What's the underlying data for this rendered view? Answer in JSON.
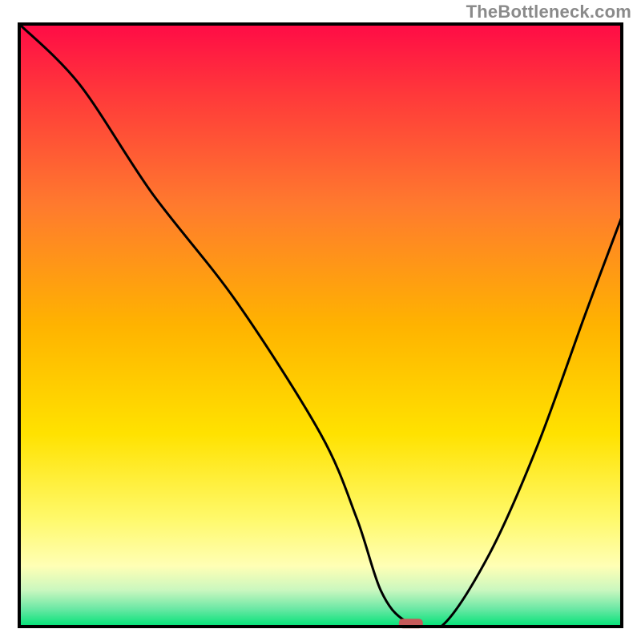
{
  "attribution": "TheBottleneck.com",
  "chart_data": {
    "type": "line",
    "title": "",
    "xlabel": "",
    "ylabel": "",
    "xlim": [
      0,
      100
    ],
    "ylim": [
      0,
      100
    ],
    "grid": false,
    "background": {
      "type": "vertical-gradient",
      "stops": [
        {
          "offset": 0.0,
          "color": "#ff0b46"
        },
        {
          "offset": 0.12,
          "color": "#ff3a3a"
        },
        {
          "offset": 0.3,
          "color": "#ff7a2e"
        },
        {
          "offset": 0.5,
          "color": "#ffb300"
        },
        {
          "offset": 0.68,
          "color": "#ffe200"
        },
        {
          "offset": 0.82,
          "color": "#fff96a"
        },
        {
          "offset": 0.9,
          "color": "#ffffb5"
        },
        {
          "offset": 0.94,
          "color": "#c9f7bf"
        },
        {
          "offset": 0.97,
          "color": "#6de8a5"
        },
        {
          "offset": 1.0,
          "color": "#00e277"
        }
      ]
    },
    "series": [
      {
        "name": "bottleneck-curve",
        "x": [
          0,
          10,
          22,
          36,
          50,
          56,
          60,
          64,
          70,
          78,
          86,
          94,
          100
        ],
        "y": [
          100,
          90,
          72,
          54,
          32,
          18,
          6,
          1,
          0,
          12,
          30,
          52,
          68
        ]
      }
    ],
    "marker": {
      "x": 65,
      "y": 0.5,
      "color": "#c65a5a",
      "shape": "rounded-rect"
    }
  }
}
